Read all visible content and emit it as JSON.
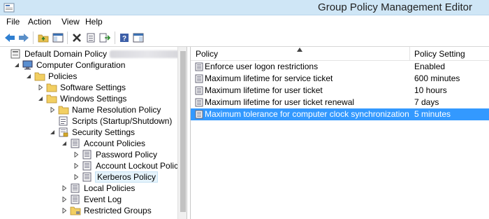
{
  "window": {
    "title": "Group Policy Management Editor"
  },
  "menu": [
    "File",
    "Action",
    "View",
    "Help"
  ],
  "toolbar": {
    "buttons": [
      {
        "name": "back-arrow-icon"
      },
      {
        "name": "forward-arrow-icon"
      },
      {
        "name": "up-folder-icon"
      },
      {
        "name": "show-hide-tree-icon"
      },
      {
        "name": "delete-icon"
      },
      {
        "name": "properties-icon"
      },
      {
        "name": "export-list-icon"
      },
      {
        "name": "help-icon"
      },
      {
        "name": "show-action-pane-icon"
      }
    ]
  },
  "tree": [
    {
      "label": "Default Domain Policy",
      "suffix": "Polic",
      "level": 0,
      "toggle": "none",
      "icon": "gpo"
    },
    {
      "label": "Computer Configuration",
      "level": 1,
      "toggle": "expanded",
      "icon": "computer"
    },
    {
      "label": "Policies",
      "level": 2,
      "toggle": "expanded",
      "icon": "folder"
    },
    {
      "label": "Software Settings",
      "level": 3,
      "toggle": "collapsed",
      "icon": "folder"
    },
    {
      "label": "Windows Settings",
      "level": 3,
      "toggle": "expanded",
      "icon": "folder"
    },
    {
      "label": "Name Resolution Policy",
      "level": 4,
      "toggle": "collapsed",
      "icon": "folder"
    },
    {
      "label": "Scripts (Startup/Shutdown)",
      "level": 4,
      "toggle": "none",
      "icon": "script"
    },
    {
      "label": "Security Settings",
      "level": 4,
      "toggle": "expanded",
      "icon": "security"
    },
    {
      "label": "Account Policies",
      "level": 5,
      "toggle": "expanded",
      "icon": "policy"
    },
    {
      "label": "Password Policy",
      "level": 6,
      "toggle": "collapsed",
      "icon": "policy"
    },
    {
      "label": "Account Lockout Policy",
      "level": 6,
      "toggle": "collapsed",
      "icon": "policy"
    },
    {
      "label": "Kerberos Policy",
      "level": 6,
      "toggle": "collapsed",
      "icon": "policy",
      "selected": true
    },
    {
      "label": "Local Policies",
      "level": 5,
      "toggle": "collapsed",
      "icon": "policy"
    },
    {
      "label": "Event Log",
      "level": 5,
      "toggle": "collapsed",
      "icon": "policy"
    },
    {
      "label": "Restricted Groups",
      "level": 5,
      "toggle": "collapsed",
      "icon": "folder-lock"
    }
  ],
  "table": {
    "columns": [
      "Policy",
      "Policy Setting"
    ],
    "rows": [
      {
        "policy": "Enforce user logon restrictions",
        "setting": "Enabled"
      },
      {
        "policy": "Maximum lifetime for service ticket",
        "setting": "600 minutes"
      },
      {
        "policy": "Maximum lifetime for user ticket",
        "setting": "10 hours"
      },
      {
        "policy": "Maximum lifetime for user ticket renewal",
        "setting": "7 days"
      },
      {
        "policy": "Maximum tolerance for computer clock synchronization",
        "setting": "5 minutes",
        "selected": true
      }
    ]
  },
  "colors": {
    "titlebar": "#cfe6f6",
    "selection": "#3399ff"
  }
}
